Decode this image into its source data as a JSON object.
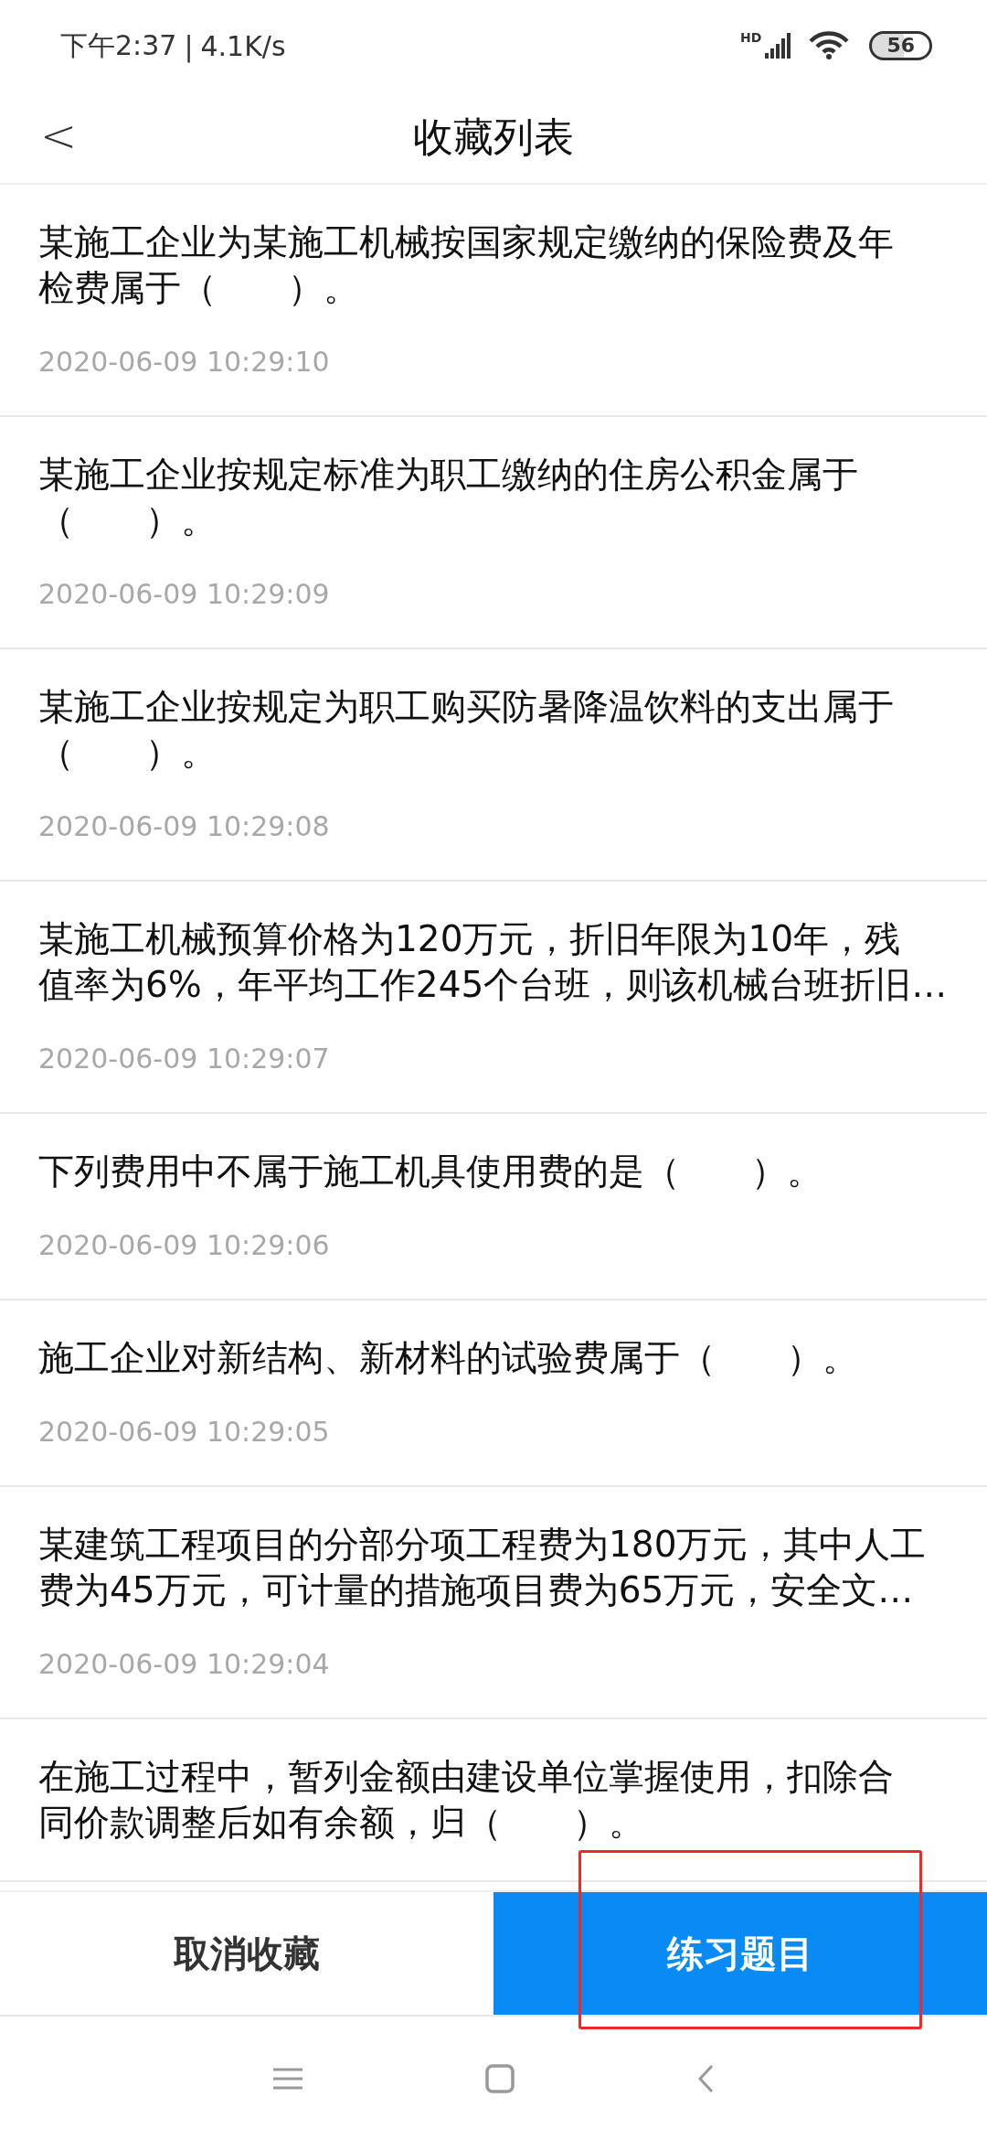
{
  "status_bar": {
    "time": "下午2:37",
    "separator": "|",
    "speed": "4.1K/s",
    "signal_label": "HD",
    "battery": "56"
  },
  "header": {
    "back": "<",
    "title": "收藏列表"
  },
  "items": [
    {
      "lines": [
        "某施工企业为某施工机械按国家规定缴纳的保险费及年",
        "检费属于（　　）。"
      ],
      "time": "2020-06-09 10:29:10"
    },
    {
      "lines": [
        "某施工企业按规定标准为职工缴纳的住房公积金属于",
        "（　　）。"
      ],
      "time": "2020-06-09 10:29:09"
    },
    {
      "lines": [
        "某施工企业按规定为职工购买防暑降温饮料的支出属于",
        "（　　）。"
      ],
      "time": "2020-06-09 10:29:08"
    },
    {
      "lines": [
        "某施工机械预算价格为120万元，折旧年限为10年，残",
        "值率为6%，年平均工作245个台班，则该机械台班折旧…"
      ],
      "time": "2020-06-09 10:29:07"
    },
    {
      "lines": [
        "下列费用中不属于施工机具使用费的是（　　）。"
      ],
      "time": "2020-06-09 10:29:06"
    },
    {
      "lines": [
        "施工企业对新结构、新材料的试验费属于（　　）。"
      ],
      "time": "2020-06-09 10:29:05"
    },
    {
      "lines": [
        "某建筑工程项目的分部分项工程费为180万元，其中人工",
        "费为45万元，可计量的措施项目费为65万元，安全文…"
      ],
      "time": "2020-06-09 10:29:04"
    },
    {
      "lines": [
        "在施工过程中，暂列金额由建设单位掌握使用，扣除合",
        "同价款调整后如有余额，归（　　）。"
      ]
    }
  ],
  "actions": [
    {
      "label": "取消收藏",
      "kind": "plain",
      "highlighted": false
    },
    {
      "label": "练习题目",
      "kind": "primary",
      "highlighted": true
    }
  ]
}
